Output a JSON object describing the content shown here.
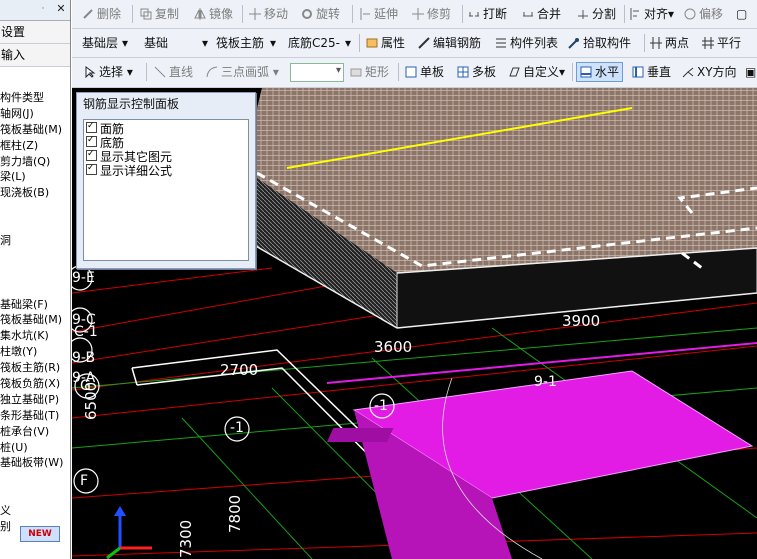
{
  "left_panel": {
    "pin_label": "ᆞ",
    "close_label": "✕",
    "row1": "设置",
    "row2": "输入",
    "tree": [
      "构件类型",
      "轴网(J)",
      "筏板基础(M)",
      "框柱(Z)",
      "剪力墙(Q)",
      "梁(L)",
      "现浇板(B)",
      "",
      "",
      "洞",
      "",
      "",
      "",
      "基础梁(F)",
      "筏板基础(M)",
      "集水坑(K)",
      "柱墩(Y)",
      "筏板主筋(R)",
      "筏板负筋(X)",
      "独立基础(P)",
      "条形基础(T)",
      "桩承台(V)",
      "桩(U)",
      "基础板带(W)",
      "",
      "",
      "义",
      "别"
    ],
    "new_badge": "NEW"
  },
  "toolbar1": {
    "items": [
      "删除",
      "复制",
      "镜像",
      "移动",
      "旋转",
      "延伸",
      "修剪",
      "打断",
      "合并",
      "分割",
      "对齐",
      "偏移"
    ]
  },
  "toolbar2": {
    "layer_value": "基础层",
    "type_value": "基础",
    "category_value": "筏板主筋",
    "member_value": "底筋C25-",
    "items": [
      "属性",
      "编辑钢筋",
      "构件列表",
      "拾取构件",
      "两点",
      "平行"
    ]
  },
  "toolbar3": {
    "items": [
      "选择",
      "直线",
      "三点画弧",
      "矩形",
      "单板",
      "多板",
      "自定义",
      "水平",
      "垂直",
      "XY方向"
    ],
    "combo_value": ""
  },
  "rebar_panel": {
    "title": "钢筋显示控制面板",
    "options": [
      "面筋",
      "底筋",
      "显示其它图元",
      "显示详细公式"
    ]
  },
  "viewport": {
    "grid_labels": [
      "9-E",
      "9-C",
      "C-1",
      "9-B",
      "9-A",
      "G",
      "F",
      "-1",
      "9-1",
      "-1"
    ],
    "dims": [
      "2700",
      "3600",
      "3900",
      "6500",
      "7800",
      "7300"
    ],
    "colors": {
      "background": "#000000",
      "grid_red": "#d00000",
      "grid_green": "#18a018",
      "slab_top": "#b39a8a",
      "magenta": "#e21ce5",
      "yellow": "#ffff00"
    }
  }
}
